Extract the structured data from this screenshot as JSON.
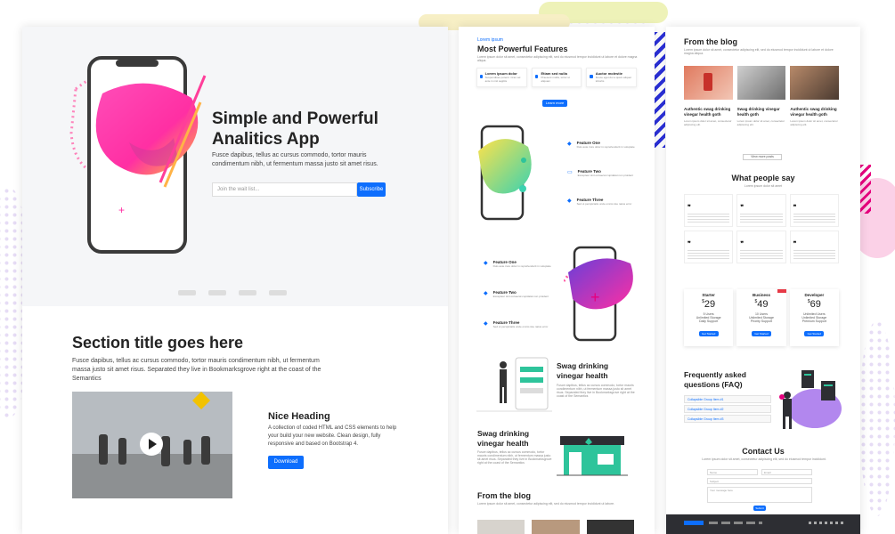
{
  "panel1": {
    "hero_title_l1": "Simple and Powerful",
    "hero_title_l2": "Analitics App",
    "hero_text": "Fusce dapibus, tellus ac cursus commodo, tortor mauris condimentum nibh, ut fermentum massa justo sit amet risus.",
    "email_placeholder": "Join the wait list...",
    "subscribe_label": "Subscribe",
    "section_title": "Section title goes here",
    "section_text": "Fusce dapibus, tellus ac cursus commodo, tortor mauris condimentum nibh, ut fermentum massa justo sit amet risus. Separated they live in Bookmarksgrove right at the coast of the Semantics",
    "nice_heading": "Nice Heading",
    "nice_text": "A collection of coded HTML and CSS elements to help your build your new website. Clean design, fully responsive and based on Bootstrap 4.",
    "download_label": "Download"
  },
  "panel2": {
    "kicker": "Lorem ipsum",
    "features_title": "Most Powerful Features",
    "features_sub": "Lorem ipsum dolor sit amet, consectetur adipiscing elit, sed do eiusmod tempor incididunt ut labore et dolore magna aliqua.",
    "cards": [
      {
        "title": "Lorem ipsum dolor",
        "text": "Suspendisse potenti. Cras vel ante in nisl sagittis"
      },
      {
        "title": "Etiam sed nulla",
        "text": "Praesent mollis, tortor ut aliquam"
      },
      {
        "title": "Auctor molestie",
        "text": "Fusce eget dui a quam aliquet lobortis"
      }
    ],
    "learn_more_label": "Learn more",
    "group1": [
      {
        "title": "Feature One",
        "text": "Duis aute irure dolor in reprehenderit in voluptate"
      },
      {
        "title": "Feature Two",
        "text": "Excepteur sint occaecat cupidatat non proident"
      },
      {
        "title": "Feature Three",
        "text": "Sed ut perspiciatis unde omnis iste natus error"
      }
    ],
    "group2": [
      {
        "title": "Feature One",
        "text": "Duis aute irure dolor in reprehenderit in voluptate"
      },
      {
        "title": "Feature Two",
        "text": "Excepteur sint occaecat cupidatat non proident"
      },
      {
        "title": "Feature Three",
        "text": "Sed ut perspiciatis unde omnis iste natus error"
      }
    ],
    "swag_title_1": "Swag drinking vinegar health",
    "swag_title_2": "Swag drinking vinegar health",
    "swag_text": "Fusce dapibus, tellus ac cursus commodo, tortor mauris condimentum nibh, ut fermentum massa justo sit amet risus. Separated they live in Bookmarksgrove right at the coast of the Semantics",
    "blog_title": "From the blog",
    "blog_text": "Lorem ipsum dolor sit amet, consectetur adipiscing elit, sed do eiusmod tempor incididunt ut labore."
  },
  "panel3": {
    "blog_title": "From the blog",
    "blog_text": "Lorem ipsum dolor sit amet, consectetur adipiscing elit, sed do eiusmod tempor incididunt ut labore et dolore magna aliqua.",
    "posts": [
      {
        "title": "Authentic swag drinking vinegar health goth",
        "text": "Lorem ipsum dolor sit amet, consectetur adipiscing elit."
      },
      {
        "title": "Swag drinking vinegar health goth",
        "text": "Lorem ipsum dolor sit amet, consectetur adipiscing elit."
      },
      {
        "title": "Authentic swag drinking vinegar health goth",
        "text": "Lorem ipsum dolor sit amet, consectetur adipiscing elit."
      }
    ],
    "view_all_label": "View more posts",
    "testi_title": "What people say",
    "testi_sub": "Lorem ipsum dolor sit amet",
    "plans": [
      {
        "name": "Starter",
        "price": "29",
        "features": [
          "5 Users",
          "Unlimited Storage",
          "Daily Support"
        ]
      },
      {
        "name": "Business",
        "price": "49",
        "features": [
          "10 Users",
          "Unlimited Storage",
          "Priority Support"
        ]
      },
      {
        "name": "Developer",
        "price": "69",
        "features": [
          "Unlimited Users",
          "Unlimited Storage",
          "Premium Support"
        ]
      }
    ],
    "get_started_label": "Get Started",
    "faq_title": "Frequently asked questions (FAQ)",
    "faq_items": [
      "Collapsible Group Item #1",
      "Collapsible Group Item #2",
      "Collapsible Group Item #3"
    ],
    "contact_title": "Contact Us",
    "contact_text": "Lorem ipsum dolor sit amet, consectetur adipiscing elit, sed do eiusmod tempor incididunt.",
    "name_placeholder": "Name",
    "email_placeholder": "Email",
    "subject_placeholder": "Subject",
    "message_placeholder": "Your message here",
    "submit_label": "Submit"
  },
  "colors": {
    "primary": "#0d6efd",
    "magenta": "#e6007e",
    "dark": "#2d2e33",
    "teal": "#2ec49b",
    "purple": "#6a3fd8"
  }
}
